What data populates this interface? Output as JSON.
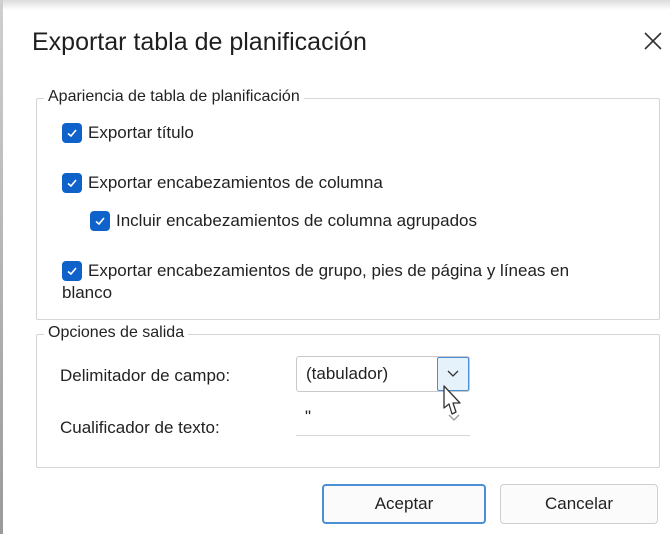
{
  "dialog": {
    "title": "Exportar tabla de planificación",
    "close_icon": "close-icon"
  },
  "appearance": {
    "legend": "Apariencia de tabla de planificación",
    "items": [
      {
        "label": "Exportar título",
        "checked": true
      },
      {
        "label": "Exportar encabezamientos de columna",
        "checked": true
      },
      {
        "label": "Incluir encabezamientos de columna agrupados",
        "checked": true
      },
      {
        "label": "Exportar encabezamientos de grupo, pies de página y líneas en",
        "label_line2": "blanco",
        "checked": true
      }
    ]
  },
  "output": {
    "legend": "Opciones de salida",
    "delimiter_label": "Delimitador de campo:",
    "delimiter_value": "(tabulador)",
    "qualifier_label": "Cualificador de texto:",
    "qualifier_value": "\""
  },
  "buttons": {
    "ok_label": "Aceptar",
    "cancel_label": "Cancelar"
  },
  "colors": {
    "checkbox": "#0f62c9",
    "accent_border": "#4b8fd6"
  }
}
